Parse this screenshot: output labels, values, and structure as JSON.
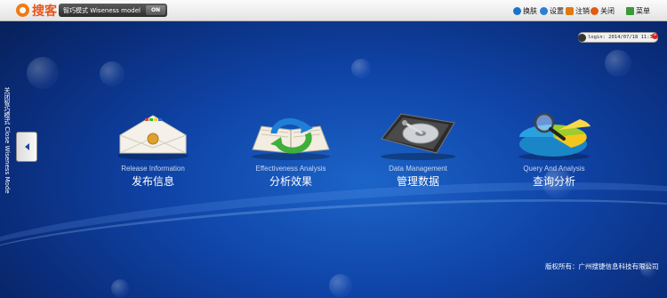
{
  "topbar": {
    "logo_text": "搜客",
    "mode_label": "智巧模式 Wiseness model",
    "mode_state": "ON",
    "tools": [
      {
        "label": "换肤",
        "icon": "skin-icon",
        "color": "#1a73c8"
      },
      {
        "label": "设置",
        "icon": "gear-icon",
        "color": "#2a7ed6"
      },
      {
        "label": "注销",
        "icon": "logout-icon",
        "color": "#e07a10"
      },
      {
        "label": "关闭",
        "icon": "close-icon",
        "color": "#e05a10"
      },
      {
        "label": "菜单",
        "icon": "menu-icon",
        "color": "#3a9a3a"
      }
    ]
  },
  "login": {
    "text": "login: 2014/07/18 11:32"
  },
  "sidebar": {
    "text": "关闭智巧模式 Close Wiseness Mode"
  },
  "modules": [
    {
      "en": "Release Information",
      "zh": "发布信息",
      "icon": "envelope-icon"
    },
    {
      "en": "Effectiveness Analysis",
      "zh": "分析效果",
      "icon": "book-refresh-icon"
    },
    {
      "en": "Data Management",
      "zh": "管理数据",
      "icon": "hard-drive-icon"
    },
    {
      "en": "Query And Analysis",
      "zh": "查询分析",
      "icon": "pie-magnifier-icon"
    }
  ],
  "footer": {
    "copyright": "版权所有：广州搜捷信息科技有限公司"
  },
  "colors": {
    "accent": "#1c64c9",
    "background_dark": "#07215c",
    "logo": "#f07a16"
  }
}
